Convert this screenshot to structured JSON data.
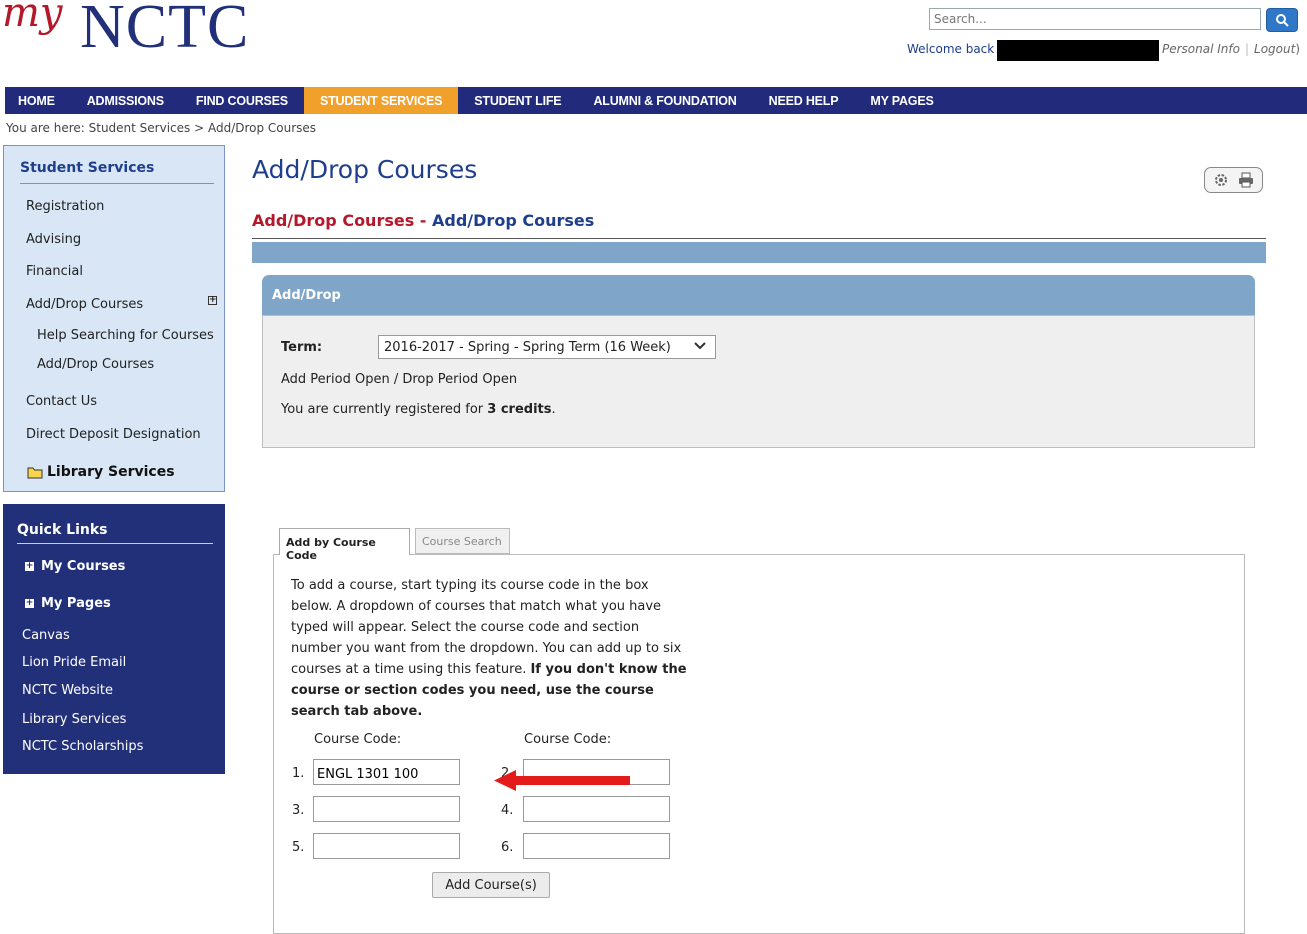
{
  "header": {
    "logo_my": "my",
    "logo_main": "NCTC",
    "search_placeholder": "Search...",
    "welcome": "Welcome back",
    "personal_info": "Personal Info",
    "logout": "Logout",
    "close_paren": ")"
  },
  "nav": {
    "items": [
      "HOME",
      "ADMISSIONS",
      "FIND COURSES",
      "STUDENT SERVICES",
      "STUDENT LIFE",
      "ALUMNI & FOUNDATION",
      "NEED HELP",
      "MY PAGES"
    ],
    "active": "STUDENT SERVICES",
    "active_color": "#f0a02b",
    "bar_color": "#222b7b"
  },
  "breadcrumb": "You are here:  Student Services > Add/Drop Courses",
  "sidebar": {
    "title": "Student Services",
    "items": [
      "Registration",
      "Advising",
      "Financial",
      "Add/Drop Courses",
      "Help Searching for Courses",
      "Add/Drop Courses",
      "Contact Us",
      "Direct Deposit Designation"
    ],
    "library": "Library Services"
  },
  "quick_links": {
    "title": "Quick Links",
    "expandable": [
      "My Courses",
      "My Pages"
    ],
    "links": [
      "Canvas",
      "Lion Pride Email",
      "NCTC Website",
      "Library Services",
      "NCTC Scholarships"
    ]
  },
  "main": {
    "title": "Add/Drop Courses",
    "subtitle_red": "Add/Drop Courses",
    "subtitle_sep": " - ",
    "subtitle_blue": "Add/Drop Courses",
    "panel_title": "Add/Drop",
    "term_label": "Term:",
    "term_value": "2016-2017 - Spring - Spring Term (16 Week)",
    "period_status": "Add Period Open / Drop Period Open",
    "credits_prefix": "You are currently registered for ",
    "credits_value": "3 credits",
    "credits_suffix": "."
  },
  "tabs": {
    "tab1": "Add by Course Code",
    "tab2": "Course Search"
  },
  "add_form": {
    "desc_normal": "To add a course, start typing its course code in the box below. A dropdown of courses that match what you have typed will appear. Select the course code and section number you want from the dropdown. You can add up to six courses at a time using this feature. ",
    "desc_bold": "If you don't know the course or section codes you need, use the course search tab above.",
    "col_label": "Course Code:",
    "numbers": [
      "1.",
      "2.",
      "3.",
      "4.",
      "5.",
      "6."
    ],
    "values": [
      "ENGL 1301 100",
      "",
      "",
      "",
      "",
      ""
    ],
    "add_button": "Add Course(s)"
  },
  "icons": {
    "search": "search-icon",
    "gear": "gear-icon",
    "print": "print-icon",
    "folder": "folder-icon",
    "arrow_color": "#e31b1b"
  }
}
